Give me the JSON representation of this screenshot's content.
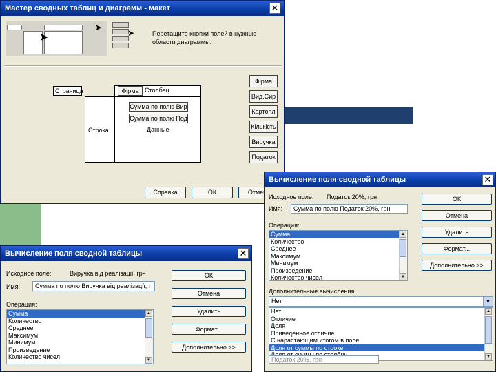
{
  "main_dialog": {
    "title": "Мастер сводных таблиц и диаграмм - макет",
    "instructions": "Перетащите кнопки полей в нужные области диаграммы.",
    "layout": {
      "page": "Страница",
      "col": "Столбец",
      "row": "Строка",
      "data": "Данные"
    },
    "field_buttons": [
      "Фірма",
      "Вид.Сир",
      "Картопл",
      "Кількість",
      "Виручка",
      "Податок"
    ],
    "placed": {
      "column_field": "Фірма",
      "data_items": [
        "Сумма по полю Вир",
        "Сумма по полю Под"
      ]
    },
    "buttons": {
      "help": "Справка",
      "ok": "ОК",
      "cancel": "Отмена"
    }
  },
  "calc_dialog_left": {
    "title": "Вычисление поля сводной таблицы",
    "source_label": "Исходное поле:",
    "source_value": "Виручка від реалізації, грн",
    "name_label": "Имя:",
    "name_value": "Сумма по полю Виручка від реалізації, г",
    "operation_label": "Операция:",
    "operations": [
      "Сумма",
      "Количество",
      "Среднее",
      "Максимум",
      "Минимум",
      "Произведение",
      "Количество чисел"
    ],
    "buttons": {
      "ok": "ОК",
      "cancel": "Отмена",
      "delete": "Удалить",
      "format": "Формат...",
      "advanced": "Дополнительно >>"
    }
  },
  "calc_dialog_right": {
    "title": "Вычисление поля сводной таблицы",
    "source_label": "Исходное поле:",
    "source_value": "Податок 20%, грн",
    "name_label": "Имя:",
    "name_value": "Сумма по полю Податок 20%, грн",
    "operation_label": "Операция:",
    "operations": [
      "Сумма",
      "Количество",
      "Среднее",
      "Максимум",
      "Минимум",
      "Произведение",
      "Количество чисел"
    ],
    "extra_label": "Дополнительные вычисления:",
    "extra_value": "Нет",
    "extra_options": [
      "Нет",
      "Отличие",
      "Доля",
      "Приведенное отличие",
      "С нарастающим итогом в поле",
      "Доля от суммы по строке",
      "Доля от суммы по столбцу"
    ],
    "base_field_value": "Податок 20%, грн",
    "buttons": {
      "ok": "ОК",
      "cancel": "Отмена",
      "delete": "Удалить",
      "format": "Формат...",
      "advanced": "Дополнительно >>"
    }
  },
  "colors": {
    "title_bar": "#0a3ea8",
    "selection": "#316ac5",
    "dialog_bg": "#ece9d8",
    "banner": "#1f3f6e",
    "green_block": "#8bbd8a"
  }
}
